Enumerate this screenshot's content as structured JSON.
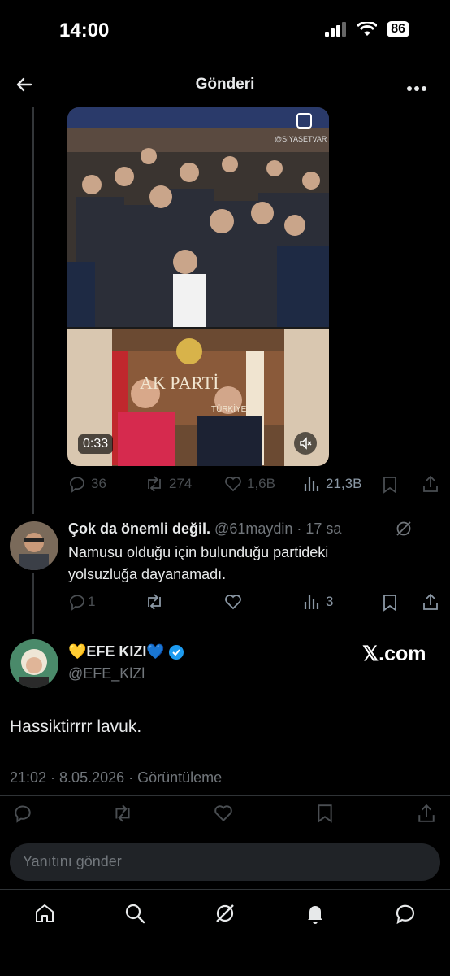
{
  "status_bar": {
    "time": "14:00",
    "battery": "86"
  },
  "header": {
    "title": "Gönderi"
  },
  "quoted_post": {
    "watermark": "@SIYASETVAR",
    "sign_text": "AK PARTİ",
    "sign_sub": "TÜRKİYE",
    "video_duration": "0:33",
    "stats": {
      "replies": "36",
      "reposts": "274",
      "likes": "1,6B",
      "views": "21,3B"
    }
  },
  "reply": {
    "name": "Çok da önemli değil.",
    "handle": "@61maydin",
    "time": "· 17 sa",
    "text": "Namusu olduğu için bulunduğu partideki yolsuzluğa dayanamadı.",
    "stats": {
      "replies": "1",
      "views": "3"
    }
  },
  "main_post": {
    "name": "💛EFE KIZI💙",
    "handle": "@EFE_KlZl",
    "brand": "𝕏.com",
    "text": "Hassiktirrrr lavuk.",
    "meta": "21:02 · 8.05.2026 · Görüntüleme"
  },
  "composer": {
    "placeholder": "Yanıtını gönder"
  },
  "icons": [
    "back-arrow-icon",
    "more-icon",
    "reply-icon",
    "repost-icon",
    "like-icon",
    "views-icon",
    "bookmark-icon",
    "share-icon",
    "grok-icon",
    "verified-icon",
    "home-icon",
    "search-icon",
    "bell-icon",
    "messages-icon"
  ]
}
